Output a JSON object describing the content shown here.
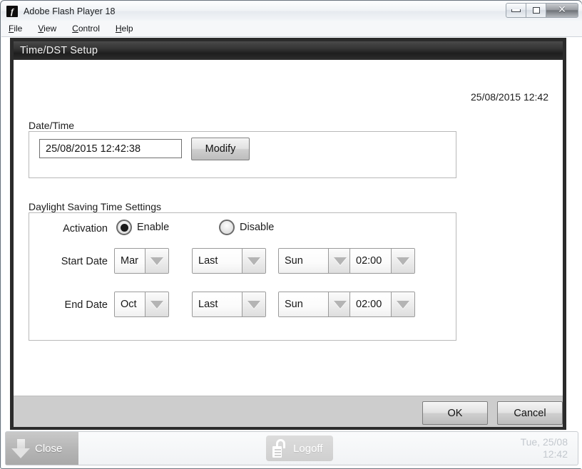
{
  "window": {
    "title": "Adobe Flash Player 18",
    "icon": "flash-logo-icon",
    "controls": {
      "minimize": "minimize-icon",
      "maximize": "maximize-icon",
      "close": "✕"
    }
  },
  "menubar": {
    "items": [
      {
        "mnemonic": "F",
        "rest": "ile"
      },
      {
        "mnemonic": "V",
        "rest": "iew"
      },
      {
        "mnemonic": "C",
        "rest": "ontrol"
      },
      {
        "mnemonic": "H",
        "rest": "elp"
      }
    ]
  },
  "dialog": {
    "title": "Time/DST Setup",
    "header_clock": "25/08/2015 12:42",
    "datetime_section": {
      "label": "Date/Time",
      "value": "25/08/2015 12:42:38",
      "modify_button": "Modify"
    },
    "dst_section": {
      "label": "Daylight Saving Time Settings",
      "activation_label": "Activation",
      "radios": [
        {
          "label": "Enable",
          "checked": true
        },
        {
          "label": "Disable",
          "checked": false
        }
      ],
      "rows": [
        {
          "label": "Start Date",
          "month": "Mar",
          "week": "Last",
          "day": "Sun",
          "time": "02:00"
        },
        {
          "label": "End Date",
          "month": "Oct",
          "week": "Last",
          "day": "Sun",
          "time": "02:00"
        }
      ]
    },
    "footer": {
      "ok": "OK",
      "cancel": "Cancel"
    }
  },
  "statusbar": {
    "close_label": "Close",
    "close_icon": "arrow-down-icon",
    "logoff_label": "Logoff",
    "logoff_icon": "padlock-open-icon",
    "clock_day": "Tue, 25/08",
    "clock_time": "12:42"
  }
}
